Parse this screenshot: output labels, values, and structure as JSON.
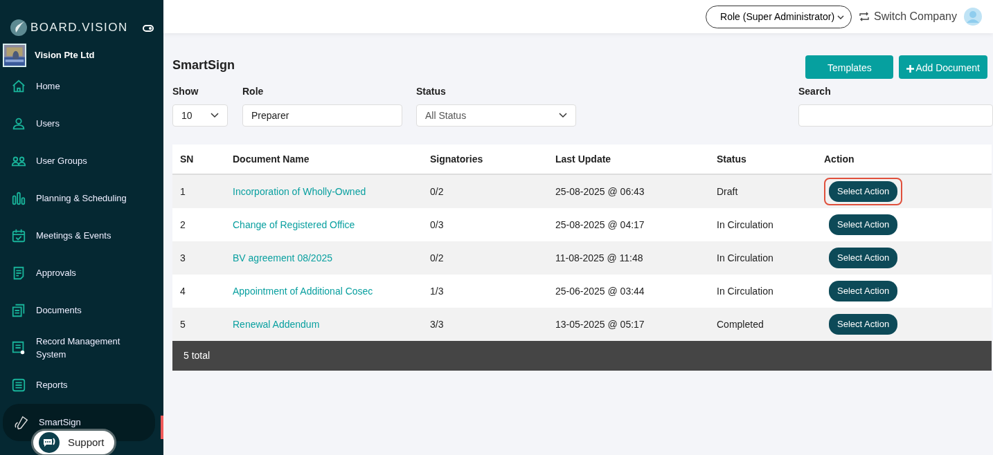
{
  "brand": {
    "name": "BOARD.VISION"
  },
  "company": {
    "name": "Vision Pte Ltd"
  },
  "sidebar": {
    "items": [
      {
        "label": "Home",
        "kind": "home",
        "selected": false
      },
      {
        "label": "Users",
        "kind": "user",
        "selected": false
      },
      {
        "label": "User Groups",
        "kind": "group",
        "selected": false
      },
      {
        "label": "Planning & Scheduling",
        "kind": "chart",
        "selected": false
      },
      {
        "label": "Meetings & Events",
        "kind": "calendar",
        "selected": false
      },
      {
        "label": "Approvals",
        "kind": "note",
        "selected": false
      },
      {
        "label": "Documents",
        "kind": "docs",
        "selected": false
      },
      {
        "label": "Record Management System",
        "kind": "record",
        "selected": false
      },
      {
        "label": "Reports",
        "kind": "list",
        "selected": false
      },
      {
        "label": "SmartSign",
        "kind": "pen",
        "selected": true
      }
    ]
  },
  "support": {
    "label": "Support"
  },
  "topbar": {
    "role": "Role (Super Administrator)",
    "switch": "Switch Company"
  },
  "page": {
    "title": "SmartSign",
    "buttons": [
      {
        "label": "Templates",
        "kind": "plain"
      },
      {
        "label": "Add Document",
        "kind": "add"
      }
    ]
  },
  "filters": {
    "show": {
      "label": "Show",
      "value": "10"
    },
    "role": {
      "label": "Role",
      "value": "Preparer"
    },
    "status": {
      "label": "Status",
      "value": "All Status"
    },
    "search": {
      "label": "Search"
    }
  },
  "table": {
    "columns": [
      "SN",
      "Document Name",
      "Signatories",
      "Last Update",
      "Status",
      "Action"
    ],
    "rows": [
      {
        "sn": "1",
        "name": "Incorporation of Wholly-Owned",
        "signatories": "0/2",
        "updated": "25-08-2025 @ 06:43",
        "status": "Draft",
        "action": "Select Action",
        "highlighted": true
      },
      {
        "sn": "2",
        "name": "Change of Registered Office",
        "signatories": "0/3",
        "updated": "25-08-2025 @ 04:17",
        "status": "In Circulation",
        "action": "Select Action",
        "highlighted": false
      },
      {
        "sn": "3",
        "name": "BV agreement 08/2025",
        "signatories": "0/2",
        "updated": "11-08-2025 @ 11:48",
        "status": "In Circulation",
        "action": "Select Action",
        "highlighted": false
      },
      {
        "sn": "4",
        "name": "Appointment of Additional Cosec",
        "signatories": "1/3",
        "updated": "25-06-2025 @ 03:44",
        "status": "In Circulation",
        "action": "Select Action",
        "highlighted": false
      },
      {
        "sn": "5",
        "name": "Renewal Addendum",
        "signatories": "3/3",
        "updated": "13-05-2025 @ 05:17",
        "status": "Completed",
        "action": "Select Action",
        "highlighted": false
      }
    ],
    "footer": "5 total"
  }
}
